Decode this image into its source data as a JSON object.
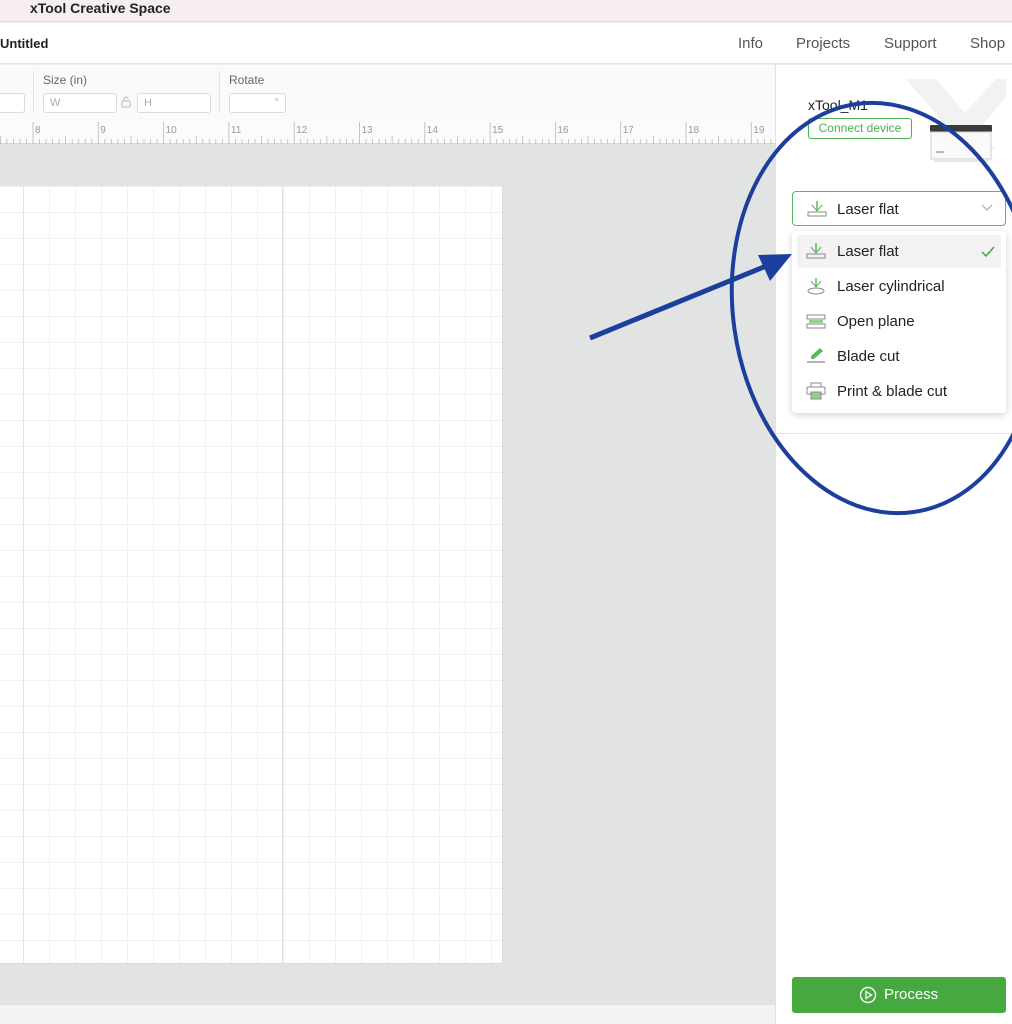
{
  "app": {
    "title": "xTool Creative Space"
  },
  "document": {
    "title": "Untitled"
  },
  "nav": {
    "items": [
      "Info",
      "Projects",
      "Support",
      "Shop"
    ]
  },
  "properties": {
    "size_label": "Size (in)",
    "width_placeholder": "W",
    "height_placeholder": "H",
    "rotate_label": "Rotate",
    "rotate_unit": "°"
  },
  "ruler": {
    "ticks": [
      "8",
      "9",
      "10",
      "11",
      "12",
      "13",
      "14",
      "15",
      "16",
      "17",
      "18",
      "19"
    ]
  },
  "device": {
    "name": "xTool_M1",
    "connect_label": "Connect device"
  },
  "mode": {
    "selected": "Laser flat",
    "options": [
      {
        "label": "Laser flat",
        "icon": "laser-flat-icon",
        "checked": true
      },
      {
        "label": "Laser cylindrical",
        "icon": "laser-cylindrical-icon",
        "checked": false
      },
      {
        "label": "Open plane",
        "icon": "open-plane-icon",
        "checked": false
      },
      {
        "label": "Blade cut",
        "icon": "blade-cut-icon",
        "checked": false
      },
      {
        "label": "Print & blade cut",
        "icon": "print-blade-cut-icon",
        "checked": false
      }
    ]
  },
  "actions": {
    "process_label": "Process"
  },
  "colors": {
    "accent_green": "#46a93f",
    "annotation_blue": "#1c3f9e"
  }
}
